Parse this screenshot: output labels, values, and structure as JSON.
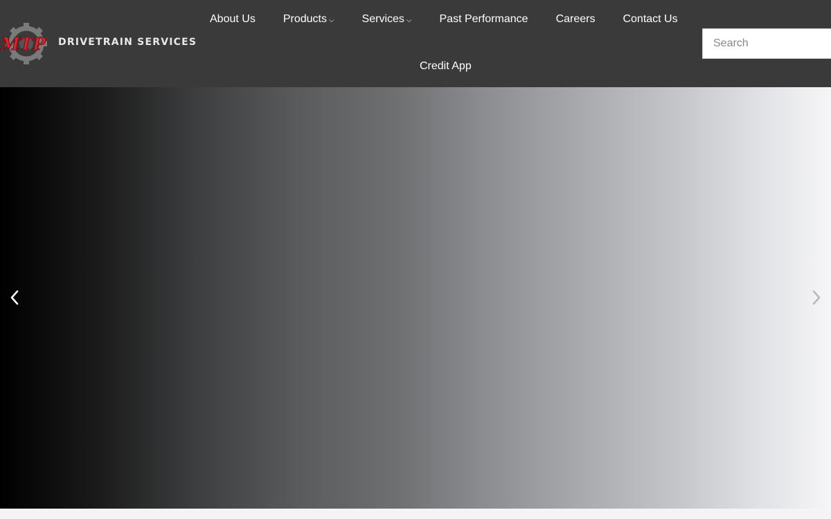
{
  "logo": {
    "letters": "MTP",
    "wordmark": "DRIVETRAIN SERVICES",
    "letters_color": "#d4232a",
    "gear_color": "#7a7a7a"
  },
  "nav": {
    "row1": [
      {
        "label": "About Us",
        "dropdown": false
      },
      {
        "label": "Products",
        "dropdown": true
      },
      {
        "label": "Services",
        "dropdown": true
      },
      {
        "label": "Past Performance",
        "dropdown": false
      },
      {
        "label": "Careers",
        "dropdown": false
      },
      {
        "label": "Contact Us",
        "dropdown": false
      }
    ],
    "row2": [
      {
        "label": "Credit App",
        "dropdown": false
      }
    ],
    "caret_glyph": "⌵"
  },
  "search": {
    "placeholder": "Search",
    "value": ""
  },
  "hero": {
    "prev_icon": "chevron-left-icon",
    "next_icon": "chevron-right-icon"
  },
  "colors": {
    "header_bg": "#3a3a3a",
    "nav_text": "#ffffff"
  }
}
